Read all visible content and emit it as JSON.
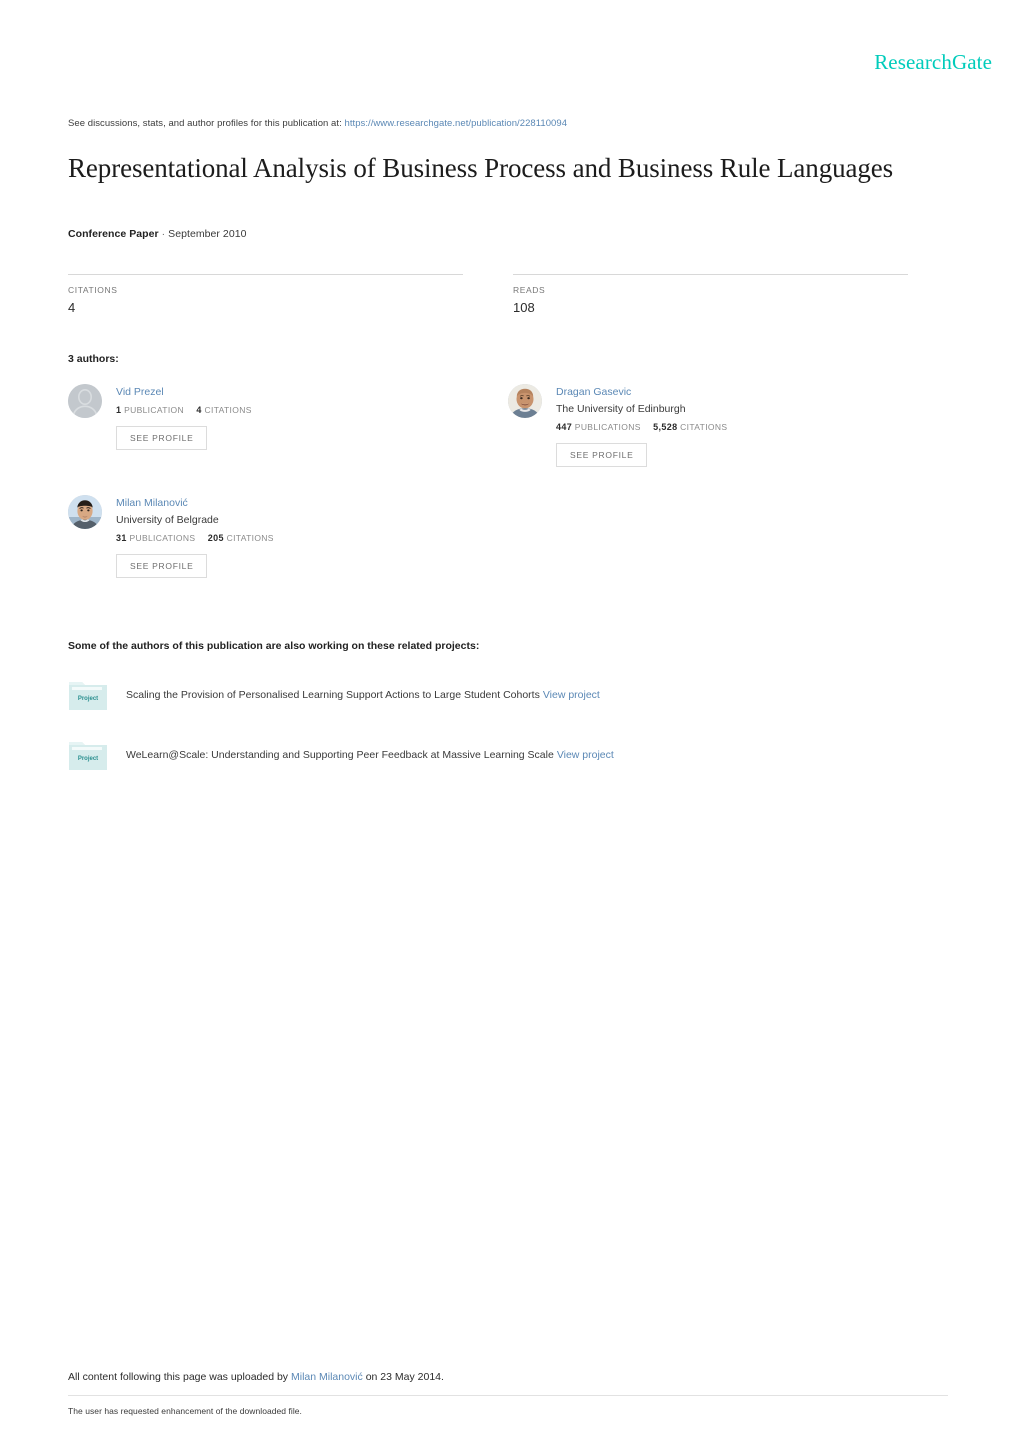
{
  "brand": {
    "logo_text": "ResearchGate",
    "logo_color": "#00ccbb"
  },
  "header": {
    "discussion_prefix": "See discussions, stats, and author profiles for this publication at:",
    "publication_url": "https://www.researchgate.net/publication/228110094"
  },
  "publication": {
    "title": "Representational Analysis of Business Process and Business Rule Languages",
    "type": "Conference Paper",
    "separator": "·",
    "date": "September 2010"
  },
  "metrics": [
    {
      "label": "CITATIONS",
      "value": "4"
    },
    {
      "label": "READS",
      "value": "108"
    }
  ],
  "authors_section": {
    "heading": "3 authors:",
    "see_profile_label": "SEE PROFILE",
    "publications_word": "PUBLICATIONS",
    "publication_word_singular": "PUBLICATION",
    "citations_word": "CITATIONS",
    "link_color": "#5b88b5"
  },
  "authors": [
    {
      "name": "Vid Prezel",
      "affiliation": "",
      "publications": "1",
      "publications_word": "PUBLICATION",
      "citations": "4",
      "citations_word": "CITATIONS",
      "avatar_type": "placeholder",
      "see_profile_label": "SEE PROFILE"
    },
    {
      "name": "Dragan Gasevic",
      "affiliation": "The University of Edinburgh",
      "publications": "447",
      "publications_word": "PUBLICATIONS",
      "citations": "5,528",
      "citations_word": "CITATIONS",
      "avatar_type": "photo-male-bald",
      "see_profile_label": "SEE PROFILE"
    },
    {
      "name": "Milan Milanović",
      "affiliation": "University of Belgrade",
      "publications": "31",
      "publications_word": "PUBLICATIONS",
      "citations": "205",
      "citations_word": "CITATIONS",
      "avatar_type": "photo-male-dark-hair",
      "see_profile_label": "SEE PROFILE"
    }
  ],
  "projects_section": {
    "heading": "Some of the authors of this publication are also working on these related projects:",
    "icon_label": "Project",
    "view_project_label": "View project"
  },
  "projects": [
    {
      "title": "Scaling the Provision of Personalised Learning Support Actions to Large Student Cohorts",
      "link_label": "View project"
    },
    {
      "title": "WeLearn@Scale: Understanding and Supporting Peer Feedback at Massive Learning Scale",
      "link_label": "View project"
    }
  ],
  "footer": {
    "upload_prefix": "All content following this page was uploaded by",
    "uploader": "Milan Milanović",
    "upload_suffix": "on 23 May 2014.",
    "note": "The user has requested enhancement of the downloaded file."
  }
}
